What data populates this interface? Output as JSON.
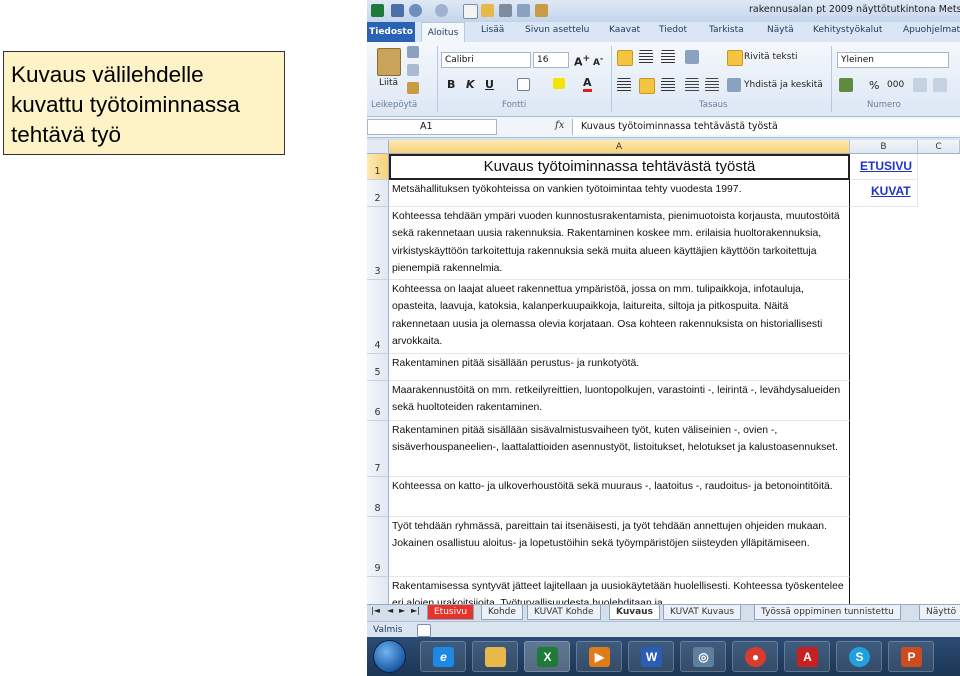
{
  "callout": {
    "line1": "Kuvaus välilehdelle",
    "line2": "kuvattu työtoiminnassa",
    "line3": "tehtävä työ"
  },
  "window": {
    "title": "rakennusalan pt 2009 näyttötutkintona Metsäha"
  },
  "ribbon_tabs": [
    "Tiedosto",
    "Aloitus",
    "Lisää",
    "Sivun asettelu",
    "Kaavat",
    "Tiedot",
    "Tarkista",
    "Näytä",
    "Kehitystyökalut",
    "Apuohjelmat"
  ],
  "ribbon": {
    "paste_label": "Liitä",
    "font_name": "Calibri",
    "font_size": "16",
    "bold": "B",
    "italic": "K",
    "underline": "U",
    "wrap_text": "Rivitä teksti",
    "merge_center": "Yhdistä ja keskitä",
    "number_format": "Yleinen",
    "percent": "%",
    "thousands": "000",
    "groups": {
      "clipboard": "Leikepöytä",
      "font": "Fontti",
      "alignment": "Tasaus",
      "number": "Numero"
    }
  },
  "formula_bar": {
    "name_box": "A1",
    "fx": "fx",
    "content": "Kuvaus työtoiminnassa tehtävästä työstä"
  },
  "columns": [
    "A",
    "B",
    "C"
  ],
  "rows": [
    {
      "num": "1",
      "a": "Kuvaus työtoiminnassa tehtävästä työstä",
      "b": "ETUSIVU"
    },
    {
      "num": "2",
      "a": "Metsähallituksen työkohteissa on vankien työtoimintaa tehty vuodesta 1997.",
      "b": "KUVAT"
    },
    {
      "num": "3",
      "a": "Kohteessa tehdään ympäri vuoden kunnostusrakentamista, pienimuotoista korjausta, muutostöitä sekä rakennetaan uusia rakennuksia. Rakentaminen koskee mm. erilaisia huoltorakennuksia, virkistyskäyttöön tarkoitettuja rakennuksia sekä muita alueen käyttäjien käyttöön tarkoitettuja pienempiä rakennelmia.",
      "b": ""
    },
    {
      "num": "4",
      "a": "Kohteessa on laajat alueet rakennettua ympäristöä, jossa on mm. tulipaikkoja, infotauluja, opasteita, laavuja, katoksia, kalanperkuupaikkoja, laitureita, siltoja ja pitkospuita. Näitä rakennetaan uusia ja olemassa olevia korjataan. Osa kohteen rakennuksista on historiallisesti arvokkaita.",
      "b": ""
    },
    {
      "num": "5",
      "a": "Rakentaminen pitää sisällään perustus- ja runkotyötä.",
      "b": ""
    },
    {
      "num": "6",
      "a": "Maarakennustöitä on mm. retkeilyreittien, luontopolkujen, varastointi -, leirintä -, levähdysalueiden sekä huoltoteiden rakentaminen.",
      "b": ""
    },
    {
      "num": "7",
      "a": "Rakentaminen pitää sisällään sisävalmistusvaiheen työt, kuten väliseinien -, ovien -, sisäverhouspaneelien-, laattalattioiden asennustyöt, listoitukset, helotukset ja kalustoasennukset.",
      "b": ""
    },
    {
      "num": "8",
      "a": "Kohteessa on katto- ja ulkoverhoustöitä sekä muuraus -, laatoitus -, raudoitus- ja betonointitöitä.",
      "b": ""
    },
    {
      "num": "9",
      "a": "Työt tehdään ryhmässä, pareittain tai itsenäisesti, ja työt tehdään annettujen ohjeiden mukaan. Jokainen osallistuu aloitus- ja lopetustöihin sekä työympäristöjen siisteyden ylläpitämiseen.",
      "b": ""
    },
    {
      "num": "",
      "a": "Rakentamisessa syntyvät jätteet lajitellaan ja uusiokäytetään huolellisesti. Kohteessa työskentelee eri alojen urakoitsijoita. Työturvallisuudesta huolehditaan ja",
      "b": ""
    }
  ],
  "sheet_tabs": [
    "Etusivu",
    "Kohde",
    "KUVAT Kohde",
    "Kuvaus",
    "KUVAT Kuvaus",
    "Työssä oppiminen tunnistettu",
    "Näyttö"
  ],
  "status": {
    "ready": "Valmis"
  },
  "taskbar": {
    "icons": [
      "windows-start-icon",
      "internet-explorer-icon",
      "file-explorer-icon",
      "excel-icon",
      "media-player-icon",
      "word-icon",
      "remote-desktop-icon",
      "chrome-icon",
      "acrobat-icon",
      "skype-icon",
      "powerpoint-icon"
    ],
    "glyphs": [
      "",
      "e",
      "",
      "X",
      "▶",
      "W",
      "◎",
      "●",
      "A",
      "S",
      "P"
    ]
  },
  "colors": {
    "accent": "#2a62b6",
    "link": "#1f33c8",
    "callout_bg": "#fdf3c6",
    "active_sheet_tab": "#e8332a"
  }
}
